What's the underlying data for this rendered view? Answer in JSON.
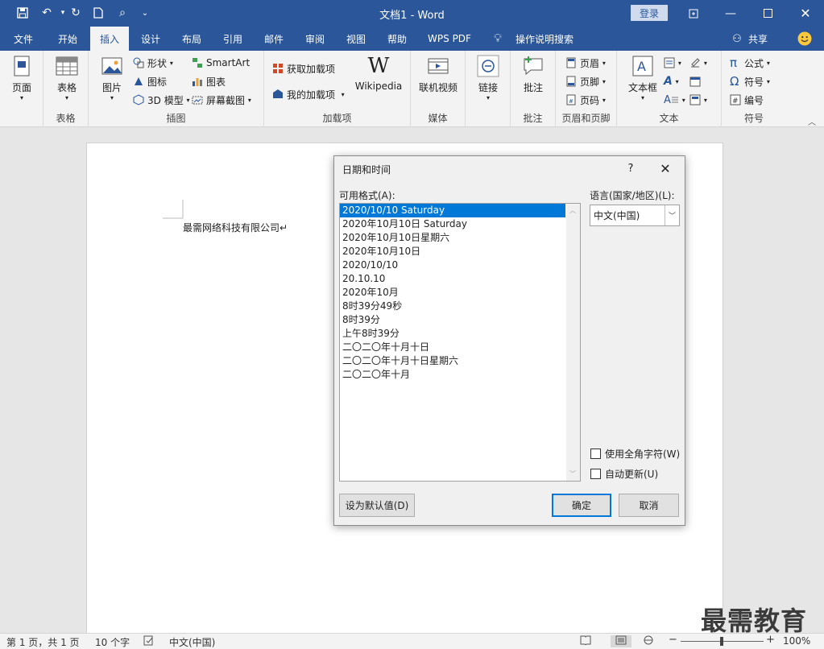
{
  "app": {
    "title": "文档1  -  Word",
    "login": "登录",
    "brand_color": "#2b579a"
  },
  "tabs": [
    {
      "label": "文件"
    },
    {
      "label": "开始"
    },
    {
      "label": "插入"
    },
    {
      "label": "设计"
    },
    {
      "label": "布局"
    },
    {
      "label": "引用"
    },
    {
      "label": "邮件"
    },
    {
      "label": "审阅"
    },
    {
      "label": "视图"
    },
    {
      "label": "帮助"
    },
    {
      "label": "WPS PDF"
    },
    {
      "label": "操作说明搜索"
    }
  ],
  "share_label": "共享",
  "ribbon": {
    "groups": {
      "pages": "页面",
      "tables": "表格",
      "illustrations": "插图",
      "addins": "加载项",
      "media": "媒体",
      "links": "链接",
      "comments": "批注",
      "header_footer": "页眉和页脚",
      "text": "文本",
      "symbols": "符号"
    },
    "pages_btn": "页面",
    "table_btn": "表格",
    "picture_btn": "图片",
    "shapes_btn": "形状",
    "icons_btn": "图标",
    "model3d_btn": "3D 模型",
    "smartart_btn": "SmartArt",
    "chart_btn": "图表",
    "screenshot_btn": "屏幕截图",
    "get_addins_btn": "获取加载项",
    "my_addins_btn": "我的加载项",
    "wikipedia_btn": "Wikipedia",
    "online_video_btn": "联机视频",
    "link_btn": "链接",
    "comment_btn": "批注",
    "header_btn": "页眉",
    "footer_btn": "页脚",
    "page_number_btn": "页码",
    "textbox_btn": "文本框",
    "equation_btn": "公式",
    "symbol_btn": "符号",
    "numbering_btn": "编号"
  },
  "document": {
    "body_text": "最需网络科技有限公司↵"
  },
  "dialog": {
    "title": "日期和时间",
    "help": "?",
    "formats_label": "可用格式(A):",
    "formats": [
      "2020/10/10 Saturday",
      "2020年10月10日 Saturday",
      "2020年10月10日星期六",
      "2020年10月10日",
      "2020/10/10",
      "20.10.10",
      "2020年10月",
      "8时39分49秒",
      "8时39分",
      "上午8时39分",
      "二〇二〇年十月十日",
      "二〇二〇年十月十日星期六",
      "二〇二〇年十月"
    ],
    "selected_index": 0,
    "language_label": "语言(国家/地区)(L):",
    "language_value": "中文(中国)",
    "fullwidth_label": "使用全角字符(W)",
    "autoupdate_label": "自动更新(U)",
    "set_default_label": "设为默认值(D)",
    "ok_label": "确定",
    "cancel_label": "取消"
  },
  "status": {
    "page": "第 1 页，共 1 页",
    "words": "10 个字",
    "language": "中文(中国)",
    "zoom": "100%"
  },
  "watermark": "最需教育"
}
